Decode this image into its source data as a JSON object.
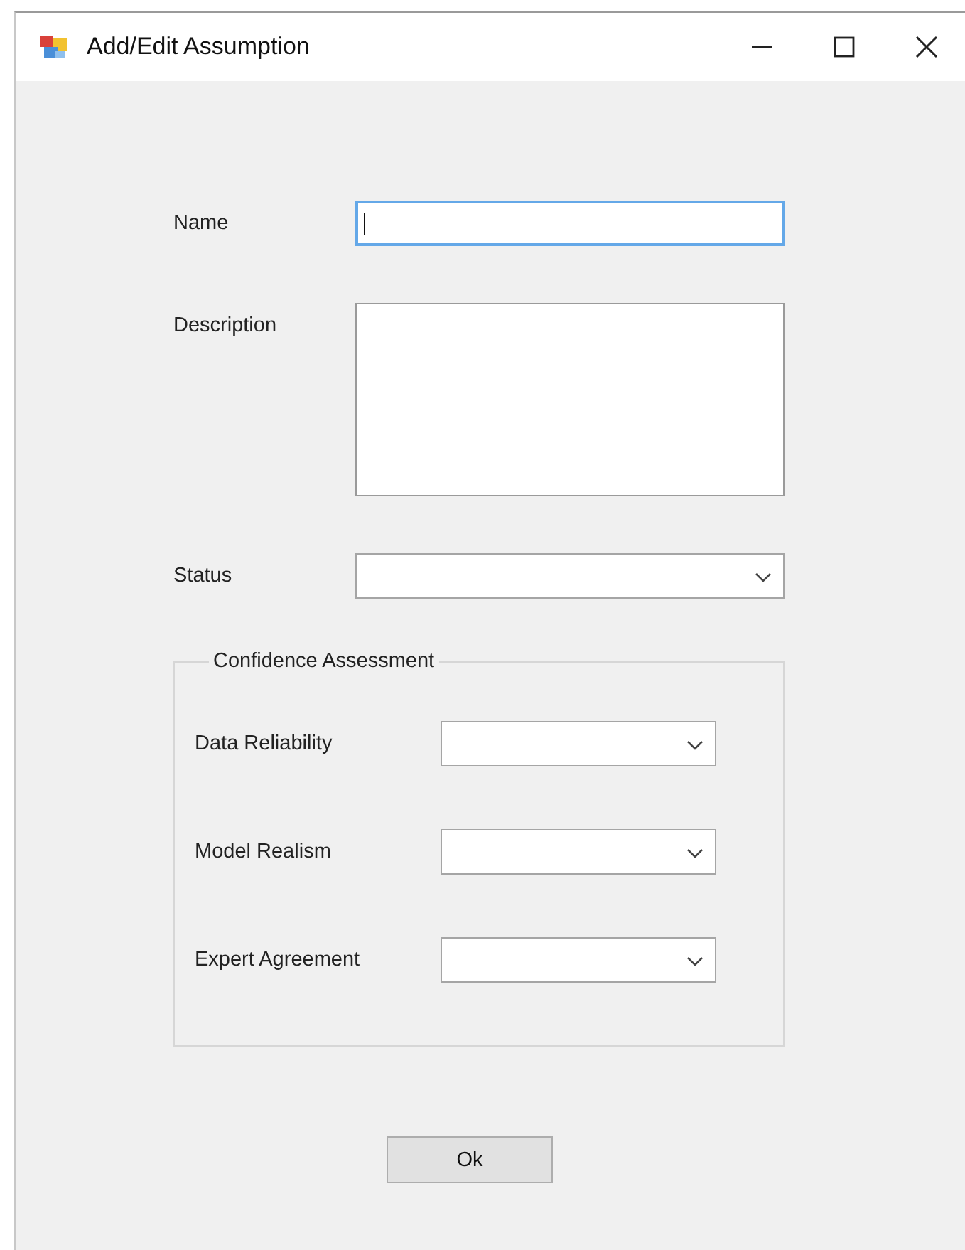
{
  "window": {
    "title": "Add/Edit Assumption"
  },
  "fields": [
    {
      "label": "Name",
      "kind": "text",
      "focused": true
    },
    {
      "label": "Description",
      "kind": "textarea",
      "focused": false
    },
    {
      "label": "Status",
      "kind": "combo",
      "focused": false
    }
  ],
  "group": {
    "title": "Confidence Assessment",
    "fields": [
      {
        "label": "Data Reliability",
        "kind": "combo"
      },
      {
        "label": "Model Realism",
        "kind": "combo"
      },
      {
        "label": "Expert Agreement",
        "kind": "combo"
      }
    ]
  },
  "buttons": [
    {
      "label": "Ok"
    }
  ]
}
